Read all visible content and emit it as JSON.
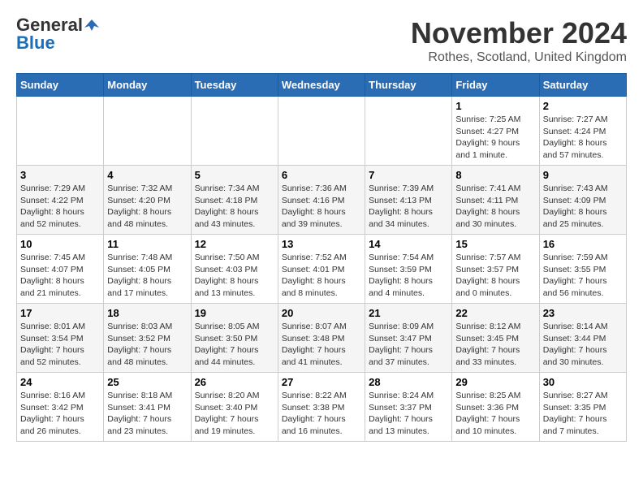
{
  "logo": {
    "general": "General",
    "blue": "Blue"
  },
  "title": "November 2024",
  "location": "Rothes, Scotland, United Kingdom",
  "weekdays": [
    "Sunday",
    "Monday",
    "Tuesday",
    "Wednesday",
    "Thursday",
    "Friday",
    "Saturday"
  ],
  "weeks": [
    [
      {
        "day": "",
        "info": ""
      },
      {
        "day": "",
        "info": ""
      },
      {
        "day": "",
        "info": ""
      },
      {
        "day": "",
        "info": ""
      },
      {
        "day": "",
        "info": ""
      },
      {
        "day": "1",
        "info": "Sunrise: 7:25 AM\nSunset: 4:27 PM\nDaylight: 9 hours\nand 1 minute."
      },
      {
        "day": "2",
        "info": "Sunrise: 7:27 AM\nSunset: 4:24 PM\nDaylight: 8 hours\nand 57 minutes."
      }
    ],
    [
      {
        "day": "3",
        "info": "Sunrise: 7:29 AM\nSunset: 4:22 PM\nDaylight: 8 hours\nand 52 minutes."
      },
      {
        "day": "4",
        "info": "Sunrise: 7:32 AM\nSunset: 4:20 PM\nDaylight: 8 hours\nand 48 minutes."
      },
      {
        "day": "5",
        "info": "Sunrise: 7:34 AM\nSunset: 4:18 PM\nDaylight: 8 hours\nand 43 minutes."
      },
      {
        "day": "6",
        "info": "Sunrise: 7:36 AM\nSunset: 4:16 PM\nDaylight: 8 hours\nand 39 minutes."
      },
      {
        "day": "7",
        "info": "Sunrise: 7:39 AM\nSunset: 4:13 PM\nDaylight: 8 hours\nand 34 minutes."
      },
      {
        "day": "8",
        "info": "Sunrise: 7:41 AM\nSunset: 4:11 PM\nDaylight: 8 hours\nand 30 minutes."
      },
      {
        "day": "9",
        "info": "Sunrise: 7:43 AM\nSunset: 4:09 PM\nDaylight: 8 hours\nand 25 minutes."
      }
    ],
    [
      {
        "day": "10",
        "info": "Sunrise: 7:45 AM\nSunset: 4:07 PM\nDaylight: 8 hours\nand 21 minutes."
      },
      {
        "day": "11",
        "info": "Sunrise: 7:48 AM\nSunset: 4:05 PM\nDaylight: 8 hours\nand 17 minutes."
      },
      {
        "day": "12",
        "info": "Sunrise: 7:50 AM\nSunset: 4:03 PM\nDaylight: 8 hours\nand 13 minutes."
      },
      {
        "day": "13",
        "info": "Sunrise: 7:52 AM\nSunset: 4:01 PM\nDaylight: 8 hours\nand 8 minutes."
      },
      {
        "day": "14",
        "info": "Sunrise: 7:54 AM\nSunset: 3:59 PM\nDaylight: 8 hours\nand 4 minutes."
      },
      {
        "day": "15",
        "info": "Sunrise: 7:57 AM\nSunset: 3:57 PM\nDaylight: 8 hours\nand 0 minutes."
      },
      {
        "day": "16",
        "info": "Sunrise: 7:59 AM\nSunset: 3:55 PM\nDaylight: 7 hours\nand 56 minutes."
      }
    ],
    [
      {
        "day": "17",
        "info": "Sunrise: 8:01 AM\nSunset: 3:54 PM\nDaylight: 7 hours\nand 52 minutes."
      },
      {
        "day": "18",
        "info": "Sunrise: 8:03 AM\nSunset: 3:52 PM\nDaylight: 7 hours\nand 48 minutes."
      },
      {
        "day": "19",
        "info": "Sunrise: 8:05 AM\nSunset: 3:50 PM\nDaylight: 7 hours\nand 44 minutes."
      },
      {
        "day": "20",
        "info": "Sunrise: 8:07 AM\nSunset: 3:48 PM\nDaylight: 7 hours\nand 41 minutes."
      },
      {
        "day": "21",
        "info": "Sunrise: 8:09 AM\nSunset: 3:47 PM\nDaylight: 7 hours\nand 37 minutes."
      },
      {
        "day": "22",
        "info": "Sunrise: 8:12 AM\nSunset: 3:45 PM\nDaylight: 7 hours\nand 33 minutes."
      },
      {
        "day": "23",
        "info": "Sunrise: 8:14 AM\nSunset: 3:44 PM\nDaylight: 7 hours\nand 30 minutes."
      }
    ],
    [
      {
        "day": "24",
        "info": "Sunrise: 8:16 AM\nSunset: 3:42 PM\nDaylight: 7 hours\nand 26 minutes."
      },
      {
        "day": "25",
        "info": "Sunrise: 8:18 AM\nSunset: 3:41 PM\nDaylight: 7 hours\nand 23 minutes."
      },
      {
        "day": "26",
        "info": "Sunrise: 8:20 AM\nSunset: 3:40 PM\nDaylight: 7 hours\nand 19 minutes."
      },
      {
        "day": "27",
        "info": "Sunrise: 8:22 AM\nSunset: 3:38 PM\nDaylight: 7 hours\nand 16 minutes."
      },
      {
        "day": "28",
        "info": "Sunrise: 8:24 AM\nSunset: 3:37 PM\nDaylight: 7 hours\nand 13 minutes."
      },
      {
        "day": "29",
        "info": "Sunrise: 8:25 AM\nSunset: 3:36 PM\nDaylight: 7 hours\nand 10 minutes."
      },
      {
        "day": "30",
        "info": "Sunrise: 8:27 AM\nSunset: 3:35 PM\nDaylight: 7 hours\nand 7 minutes."
      }
    ]
  ]
}
